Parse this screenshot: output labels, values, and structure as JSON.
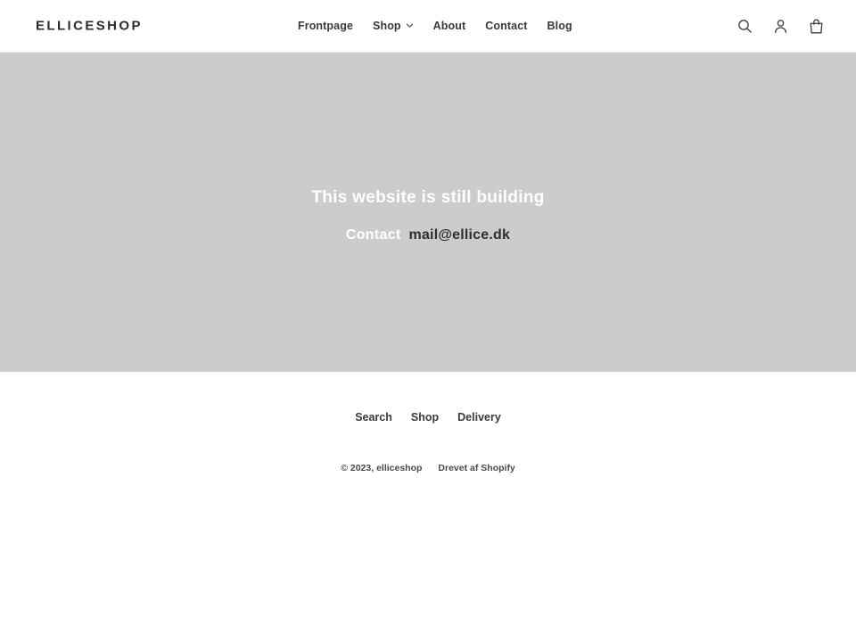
{
  "header": {
    "logo": "ELLICESHOP",
    "nav": [
      {
        "label": "Frontpage",
        "has_dropdown": false
      },
      {
        "label": "Shop",
        "has_dropdown": true
      },
      {
        "label": "About",
        "has_dropdown": false
      },
      {
        "label": "Contact",
        "has_dropdown": false
      },
      {
        "label": "Blog",
        "has_dropdown": false
      }
    ],
    "icons": [
      {
        "name": "search-icon",
        "label": "Search"
      },
      {
        "name": "account-icon",
        "label": "Log in"
      },
      {
        "name": "cart-icon",
        "label": "Cart"
      }
    ]
  },
  "hero": {
    "title": "This website is still building",
    "contact_label": "Contact",
    "contact_email": "mail@ellice.dk",
    "background_color": "#cbccce",
    "title_color": "#ffffff",
    "email_color": "#2e2e2e"
  },
  "footer": {
    "links": [
      {
        "label": "Search"
      },
      {
        "label": "Shop"
      },
      {
        "label": "Delivery"
      }
    ],
    "copyright": "© 2023, elliceshop",
    "powered_by": "Drevet af Shopify"
  }
}
